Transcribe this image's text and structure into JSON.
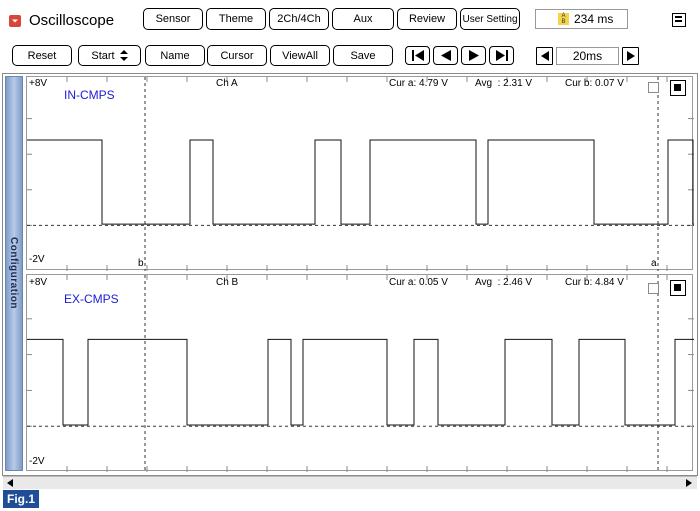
{
  "header": {
    "app_icon": "app-menu-icon",
    "title": "Oscilloscope",
    "buttons": [
      "Sensor",
      "Theme",
      "2Ch/4Ch",
      "Aux",
      "Review",
      "User Setting"
    ],
    "timer_value": "234 ms",
    "timer_icon": "ab-badge-icon",
    "menu_icon": "hamburger-menu-icon"
  },
  "toolbar": {
    "reset": "Reset",
    "start": "Start",
    "name": "Name",
    "cursor": "Cursor",
    "view_all": "ViewAll",
    "save": "Save",
    "timebase": "20ms"
  },
  "sidebar": {
    "label": "Configuration"
  },
  "channels": [
    {
      "label": "IN-CMPS",
      "channel": "Ch A",
      "ytop": "+8V",
      "ybot": "-2V",
      "cur_a": "Cur a: 4.79 V",
      "avg": "Avg  : 2.31 V",
      "cur_b": "Cur b: 0.07 V",
      "cursor_b_label": "b",
      "cursor_a_label": "a",
      "levels": {
        "high": 4.8,
        "low": 0.07
      },
      "transitions_ms": [
        0,
        37.5,
        81.5,
        93,
        144,
        157,
        171.5,
        224.5,
        230.5,
        283.5,
        320.5,
        333
      ]
    },
    {
      "label": "EX-CMPS",
      "channel": "Ch B",
      "ytop": "+8V",
      "ybot": "-2V",
      "cur_a": "Cur a: 0.05 V",
      "avg": "Avg  : 2.46 V",
      "cur_b": "Cur b: 4.84 V",
      "levels": {
        "high": 4.85,
        "low": 0.07
      },
      "transitions_ms": [
        18,
        30.5,
        80,
        120.5,
        132,
        138,
        180,
        193.5,
        205.5,
        239,
        262.5,
        276,
        299,
        324
      ]
    }
  ],
  "footer": {
    "label": "Fig.1"
  }
}
